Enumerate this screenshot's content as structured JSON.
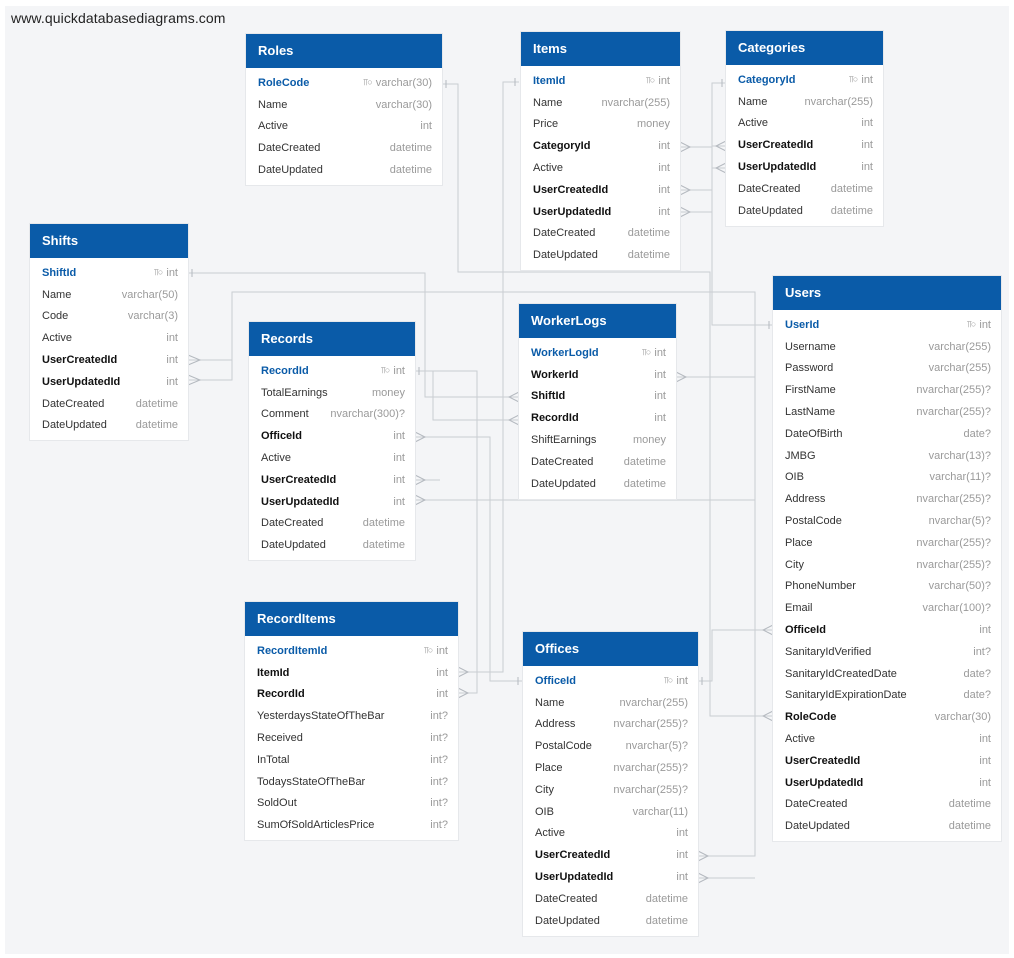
{
  "watermark": "www.quickdatabasediagrams.com",
  "key_icon": "key-icon",
  "colors": {
    "header": "#0a5ba8",
    "pk_text": "#0a5ba8",
    "background": "#f4f5f7",
    "connector": "#c9cdd2"
  },
  "tables": [
    {
      "id": "roles",
      "name": "Roles",
      "fields": [
        {
          "name": "RoleCode",
          "type": "varchar(30)",
          "pk": true
        },
        {
          "name": "Name",
          "type": "varchar(30)"
        },
        {
          "name": "Active",
          "type": "int"
        },
        {
          "name": "DateCreated",
          "type": "datetime"
        },
        {
          "name": "DateUpdated",
          "type": "datetime"
        }
      ]
    },
    {
      "id": "items",
      "name": "Items",
      "fields": [
        {
          "name": "ItemId",
          "type": "int",
          "pk": true
        },
        {
          "name": "Name",
          "type": "nvarchar(255)"
        },
        {
          "name": "Price",
          "type": "money"
        },
        {
          "name": "CategoryId",
          "type": "int",
          "fk": true
        },
        {
          "name": "Active",
          "type": "int"
        },
        {
          "name": "UserCreatedId",
          "type": "int",
          "fk": true
        },
        {
          "name": "UserUpdatedId",
          "type": "int",
          "fk": true
        },
        {
          "name": "DateCreated",
          "type": "datetime"
        },
        {
          "name": "DateUpdated",
          "type": "datetime"
        }
      ]
    },
    {
      "id": "categories",
      "name": "Categories",
      "fields": [
        {
          "name": "CategoryId",
          "type": "int",
          "pk": true
        },
        {
          "name": "Name",
          "type": "nvarchar(255)"
        },
        {
          "name": "Active",
          "type": "int"
        },
        {
          "name": "UserCreatedId",
          "type": "int",
          "fk": true
        },
        {
          "name": "UserUpdatedId",
          "type": "int",
          "fk": true
        },
        {
          "name": "DateCreated",
          "type": "datetime"
        },
        {
          "name": "DateUpdated",
          "type": "datetime"
        }
      ]
    },
    {
      "id": "shifts",
      "name": "Shifts",
      "fields": [
        {
          "name": "ShiftId",
          "type": "int",
          "pk": true
        },
        {
          "name": "Name",
          "type": "varchar(50)"
        },
        {
          "name": "Code",
          "type": "varchar(3)"
        },
        {
          "name": "Active",
          "type": "int"
        },
        {
          "name": "UserCreatedId",
          "type": "int",
          "fk": true
        },
        {
          "name": "UserUpdatedId",
          "type": "int",
          "fk": true
        },
        {
          "name": "DateCreated",
          "type": "datetime"
        },
        {
          "name": "DateUpdated",
          "type": "datetime"
        }
      ]
    },
    {
      "id": "records",
      "name": "Records",
      "fields": [
        {
          "name": "RecordId",
          "type": "int",
          "pk": true
        },
        {
          "name": "TotalEarnings",
          "type": "money"
        },
        {
          "name": "Comment",
          "type": "nvarchar(300)?"
        },
        {
          "name": "OfficeId",
          "type": "int",
          "fk": true
        },
        {
          "name": "Active",
          "type": "int"
        },
        {
          "name": "UserCreatedId",
          "type": "int",
          "fk": true
        },
        {
          "name": "UserUpdatedId",
          "type": "int",
          "fk": true
        },
        {
          "name": "DateCreated",
          "type": "datetime"
        },
        {
          "name": "DateUpdated",
          "type": "datetime"
        }
      ]
    },
    {
      "id": "workerlogs",
      "name": "WorkerLogs",
      "fields": [
        {
          "name": "WorkerLogId",
          "type": "int",
          "pk": true
        },
        {
          "name": "WorkerId",
          "type": "int",
          "fk": true
        },
        {
          "name": "ShiftId",
          "type": "int",
          "fk": true
        },
        {
          "name": "RecordId",
          "type": "int",
          "fk": true
        },
        {
          "name": "ShiftEarnings",
          "type": "money"
        },
        {
          "name": "DateCreated",
          "type": "datetime"
        },
        {
          "name": "DateUpdated",
          "type": "datetime"
        }
      ]
    },
    {
      "id": "users",
      "name": "Users",
      "fields": [
        {
          "name": "UserId",
          "type": "int",
          "pk": true
        },
        {
          "name": "Username",
          "type": "varchar(255)"
        },
        {
          "name": "Password",
          "type": "varchar(255)"
        },
        {
          "name": "FirstName",
          "type": "nvarchar(255)?"
        },
        {
          "name": "LastName",
          "type": "nvarchar(255)?"
        },
        {
          "name": "DateOfBirth",
          "type": "date?"
        },
        {
          "name": "JMBG",
          "type": "varchar(13)?"
        },
        {
          "name": "OIB",
          "type": "varchar(11)?"
        },
        {
          "name": "Address",
          "type": "nvarchar(255)?"
        },
        {
          "name": "PostalCode",
          "type": "nvarchar(5)?"
        },
        {
          "name": "Place",
          "type": "nvarchar(255)?"
        },
        {
          "name": "City",
          "type": "nvarchar(255)?"
        },
        {
          "name": "PhoneNumber",
          "type": "varchar(50)?"
        },
        {
          "name": "Email",
          "type": "varchar(100)?"
        },
        {
          "name": "OfficeId",
          "type": "int",
          "fk": true
        },
        {
          "name": "SanitaryIdVerified",
          "type": "int?"
        },
        {
          "name": "SanitaryIdCreatedDate",
          "type": "date?"
        },
        {
          "name": "SanitaryIdExpirationDate",
          "type": "date?"
        },
        {
          "name": "RoleCode",
          "type": "varchar(30)",
          "fk": true
        },
        {
          "name": "Active",
          "type": "int"
        },
        {
          "name": "UserCreatedId",
          "type": "int",
          "fk": true
        },
        {
          "name": "UserUpdatedId",
          "type": "int",
          "fk": true
        },
        {
          "name": "DateCreated",
          "type": "datetime"
        },
        {
          "name": "DateUpdated",
          "type": "datetime"
        }
      ]
    },
    {
      "id": "recorditems",
      "name": "RecordItems",
      "fields": [
        {
          "name": "RecordItemId",
          "type": "int",
          "pk": true
        },
        {
          "name": "ItemId",
          "type": "int",
          "fk": true
        },
        {
          "name": "RecordId",
          "type": "int",
          "fk": true
        },
        {
          "name": "YesterdaysStateOfTheBar",
          "type": "int?"
        },
        {
          "name": "Received",
          "type": "int?"
        },
        {
          "name": "InTotal",
          "type": "int?"
        },
        {
          "name": "TodaysStateOfTheBar",
          "type": "int?"
        },
        {
          "name": "SoldOut",
          "type": "int?"
        },
        {
          "name": "SumOfSoldArticlesPrice",
          "type": "int?"
        }
      ]
    },
    {
      "id": "offices",
      "name": "Offices",
      "fields": [
        {
          "name": "OfficeId",
          "type": "int",
          "pk": true
        },
        {
          "name": "Name",
          "type": "nvarchar(255)"
        },
        {
          "name": "Address",
          "type": "nvarchar(255)?"
        },
        {
          "name": "PostalCode",
          "type": "nvarchar(5)?"
        },
        {
          "name": "Place",
          "type": "nvarchar(255)?"
        },
        {
          "name": "City",
          "type": "nvarchar(255)?"
        },
        {
          "name": "OIB",
          "type": "varchar(11)"
        },
        {
          "name": "Active",
          "type": "int"
        },
        {
          "name": "UserCreatedId",
          "type": "int",
          "fk": true
        },
        {
          "name": "UserUpdatedId",
          "type": "int",
          "fk": true
        },
        {
          "name": "DateCreated",
          "type": "datetime"
        },
        {
          "name": "DateUpdated",
          "type": "datetime"
        }
      ]
    }
  ]
}
